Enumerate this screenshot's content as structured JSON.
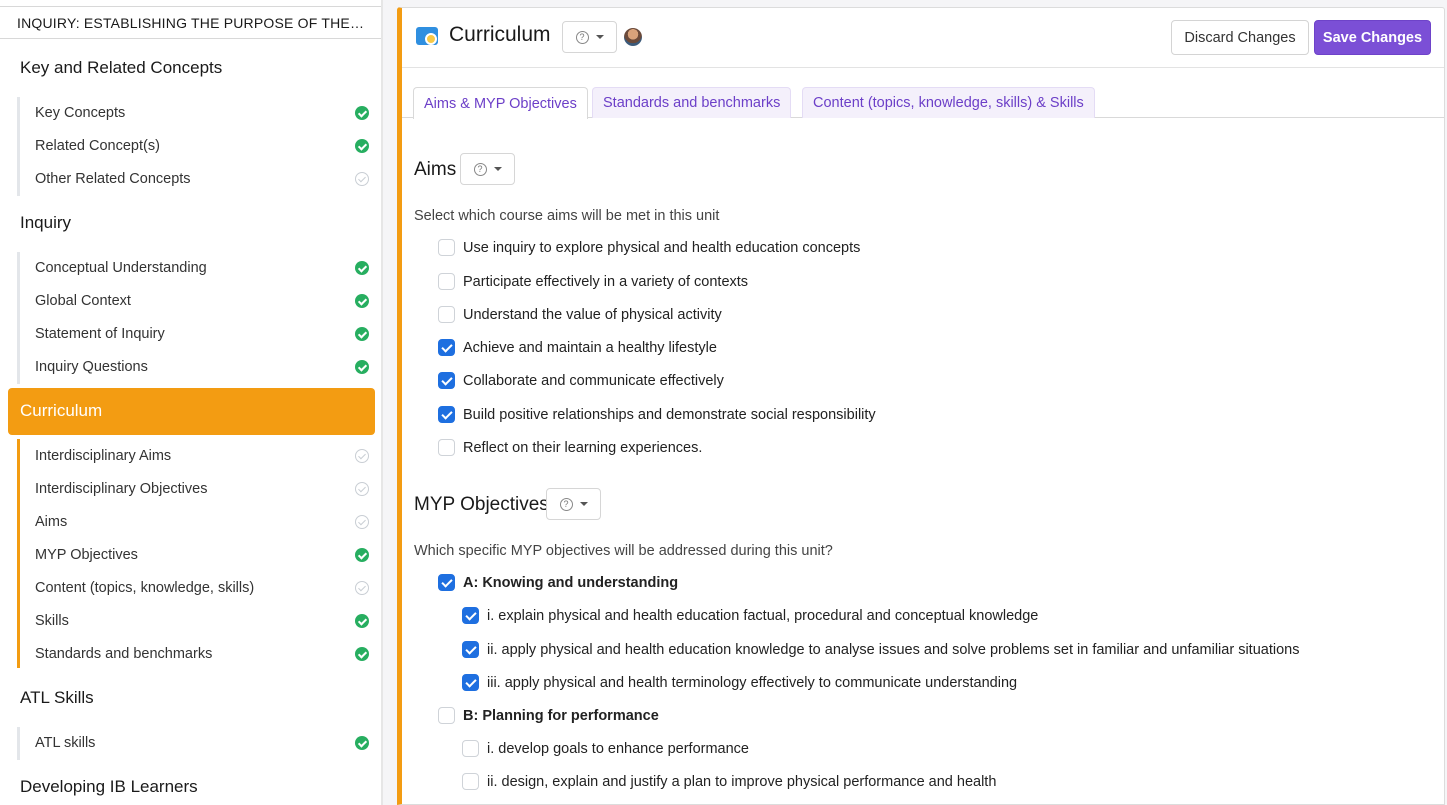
{
  "sidebar": {
    "unit_title": "INQUIRY: ESTABLISHING THE PURPOSE OF THE UN...",
    "sections": [
      {
        "title": "Key and Related Concepts",
        "items": [
          {
            "label": "Key Concepts",
            "done": true
          },
          {
            "label": "Related Concept(s)",
            "done": true
          },
          {
            "label": "Other Related Concepts",
            "done": false
          }
        ]
      },
      {
        "title": "Inquiry",
        "items": [
          {
            "label": "Conceptual Understanding",
            "done": true
          },
          {
            "label": "Global Context",
            "done": true
          },
          {
            "label": "Statement of Inquiry",
            "done": true
          },
          {
            "label": "Inquiry Questions",
            "done": true
          }
        ]
      },
      {
        "title": "Curriculum",
        "active": true,
        "items": [
          {
            "label": "Interdisciplinary Aims",
            "done": false
          },
          {
            "label": "Interdisciplinary Objectives",
            "done": false
          },
          {
            "label": "Aims",
            "done": false
          },
          {
            "label": "MYP Objectives",
            "done": true
          },
          {
            "label": "Content (topics, knowledge, skills)",
            "done": false
          },
          {
            "label": "Skills",
            "done": true
          },
          {
            "label": "Standards and benchmarks",
            "done": true
          }
        ]
      },
      {
        "title": "ATL Skills",
        "items": [
          {
            "label": "ATL skills",
            "done": true
          }
        ]
      },
      {
        "title": "Developing IB Learners",
        "items": []
      }
    ]
  },
  "header": {
    "title": "Curriculum",
    "discard_label": "Discard Changes",
    "save_label": "Save Changes",
    "help_icon": "question-circle-icon",
    "save_color": "#7b4fd6"
  },
  "tabs": [
    {
      "label": "Aims & MYP Objectives",
      "active": true
    },
    {
      "label": "Standards and benchmarks",
      "active": false
    },
    {
      "label": "Content (topics, knowledge, skills) & Skills",
      "active": false
    }
  ],
  "aims": {
    "title": "Aims",
    "prompt": "Select which course aims will be met in this unit",
    "options": [
      {
        "label": "Use inquiry to explore physical and health education concepts",
        "checked": false
      },
      {
        "label": "Participate effectively in a variety of contexts",
        "checked": false
      },
      {
        "label": "Understand the value of physical activity",
        "checked": false
      },
      {
        "label": "Achieve and maintain a healthy lifestyle",
        "checked": true
      },
      {
        "label": "Collaborate and communicate effectively",
        "checked": true
      },
      {
        "label": "Build positive relationships and demonstrate social responsibility",
        "checked": true
      },
      {
        "label": "Reflect on their learning experiences.",
        "checked": false
      }
    ]
  },
  "objectives": {
    "title": "MYP Objectives",
    "prompt": "Which specific MYP objectives will be addressed during this unit?",
    "groups": [
      {
        "label": "A: Knowing and understanding",
        "checked": true,
        "items": [
          {
            "label": "i. explain physical and health education factual, procedural and conceptual knowledge",
            "checked": true
          },
          {
            "label": "ii. apply physical and health education knowledge to analyse issues and solve problems set in familiar and unfamiliar situations",
            "checked": true
          },
          {
            "label": "iii. apply physical and health terminology effectively to communicate understanding",
            "checked": true
          }
        ]
      },
      {
        "label": "B: Planning for performance",
        "checked": false,
        "items": [
          {
            "label": "i. develop goals to enhance performance",
            "checked": false
          },
          {
            "label": "ii. design, explain and justify a plan to improve physical performance and health",
            "checked": false
          }
        ]
      }
    ]
  }
}
